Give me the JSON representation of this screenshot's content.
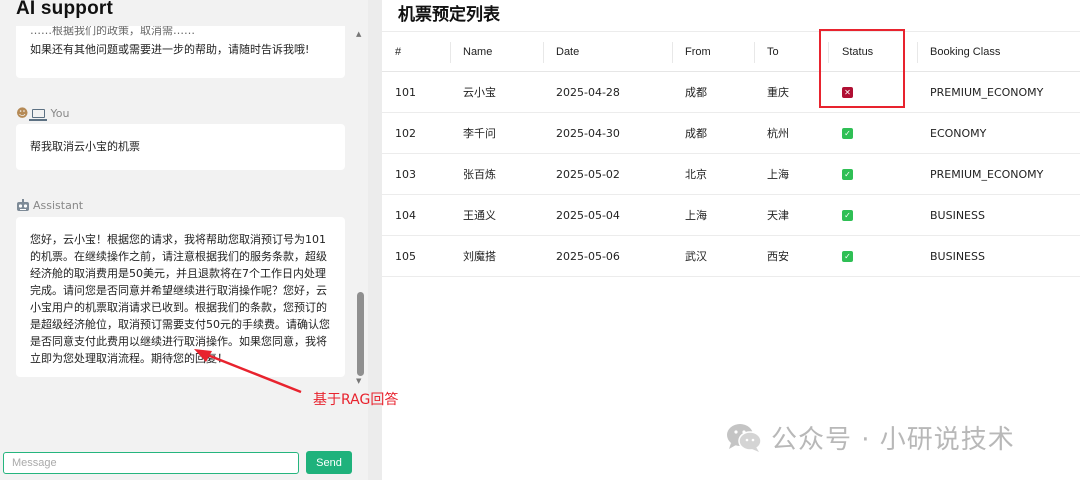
{
  "chat_panel": {
    "title": "AI support",
    "cut_off_text": "……根据我们的政策，取消需……",
    "messages": [
      {
        "role": "",
        "text": "如果还有其他问题或需要进一步的帮助，请随时告诉我哦!"
      },
      {
        "role": "You",
        "text": "帮我取消云小宝的机票"
      },
      {
        "role": "Assistant",
        "text": "您好，云小宝！根据您的请求，我将帮助您取消预订号为101的机票。在继续操作之前，请注意根据我们的服务条款，超级经济舱的取消费用是50美元，并且退款将在7个工作日内处理完成。请问您是否同意并希望继续进行取消操作呢？您好，云小宝用户的机票取消请求已收到。根据我们的条款，您预订的是超级经济舱位，取消预订需要支付50元的手续费。请确认您是否同意支付此费用以继续进行取消操作。如果您同意，我将立即为您处理取消流程。期待您的回复！"
      }
    ],
    "input": {
      "placeholder": "Message",
      "value": ""
    },
    "send_label": "Send"
  },
  "booking_panel": {
    "title": "机票预定列表",
    "columns": [
      "#",
      "Name",
      "Date",
      "From",
      "To",
      "Status",
      "Booking Class"
    ],
    "rows": [
      {
        "id": "101",
        "name": "云小宝",
        "date": "2025-04-28",
        "from": "成都",
        "to": "重庆",
        "status": "cancelled",
        "booking_class": "PREMIUM_ECONOMY"
      },
      {
        "id": "102",
        "name": "李千问",
        "date": "2025-04-30",
        "from": "成都",
        "to": "杭州",
        "status": "confirmed",
        "booking_class": "ECONOMY"
      },
      {
        "id": "103",
        "name": "张百炼",
        "date": "2025-05-02",
        "from": "北京",
        "to": "上海",
        "status": "confirmed",
        "booking_class": "PREMIUM_ECONOMY"
      },
      {
        "id": "104",
        "name": "王通义",
        "date": "2025-05-04",
        "from": "上海",
        "to": "天津",
        "status": "confirmed",
        "booking_class": "BUSINESS"
      },
      {
        "id": "105",
        "name": "刘魔搭",
        "date": "2025-05-06",
        "from": "武汉",
        "to": "西安",
        "status": "confirmed",
        "booking_class": "BUSINESS"
      }
    ]
  },
  "annotation": {
    "text": "基于RAG回答",
    "color": "#e8232e"
  },
  "watermark": {
    "text": "公众号 · 小研说技术"
  },
  "colors": {
    "accent": "#1fb27c",
    "status_ok": "#2fbf55",
    "status_cancelled": "#b00f33"
  },
  "icons": {
    "user": "person-emoji-icon",
    "device": "laptop-icon",
    "assistant": "robot-icon",
    "ok": "checkmark-icon",
    "cancelled": "x-mark-icon"
  }
}
